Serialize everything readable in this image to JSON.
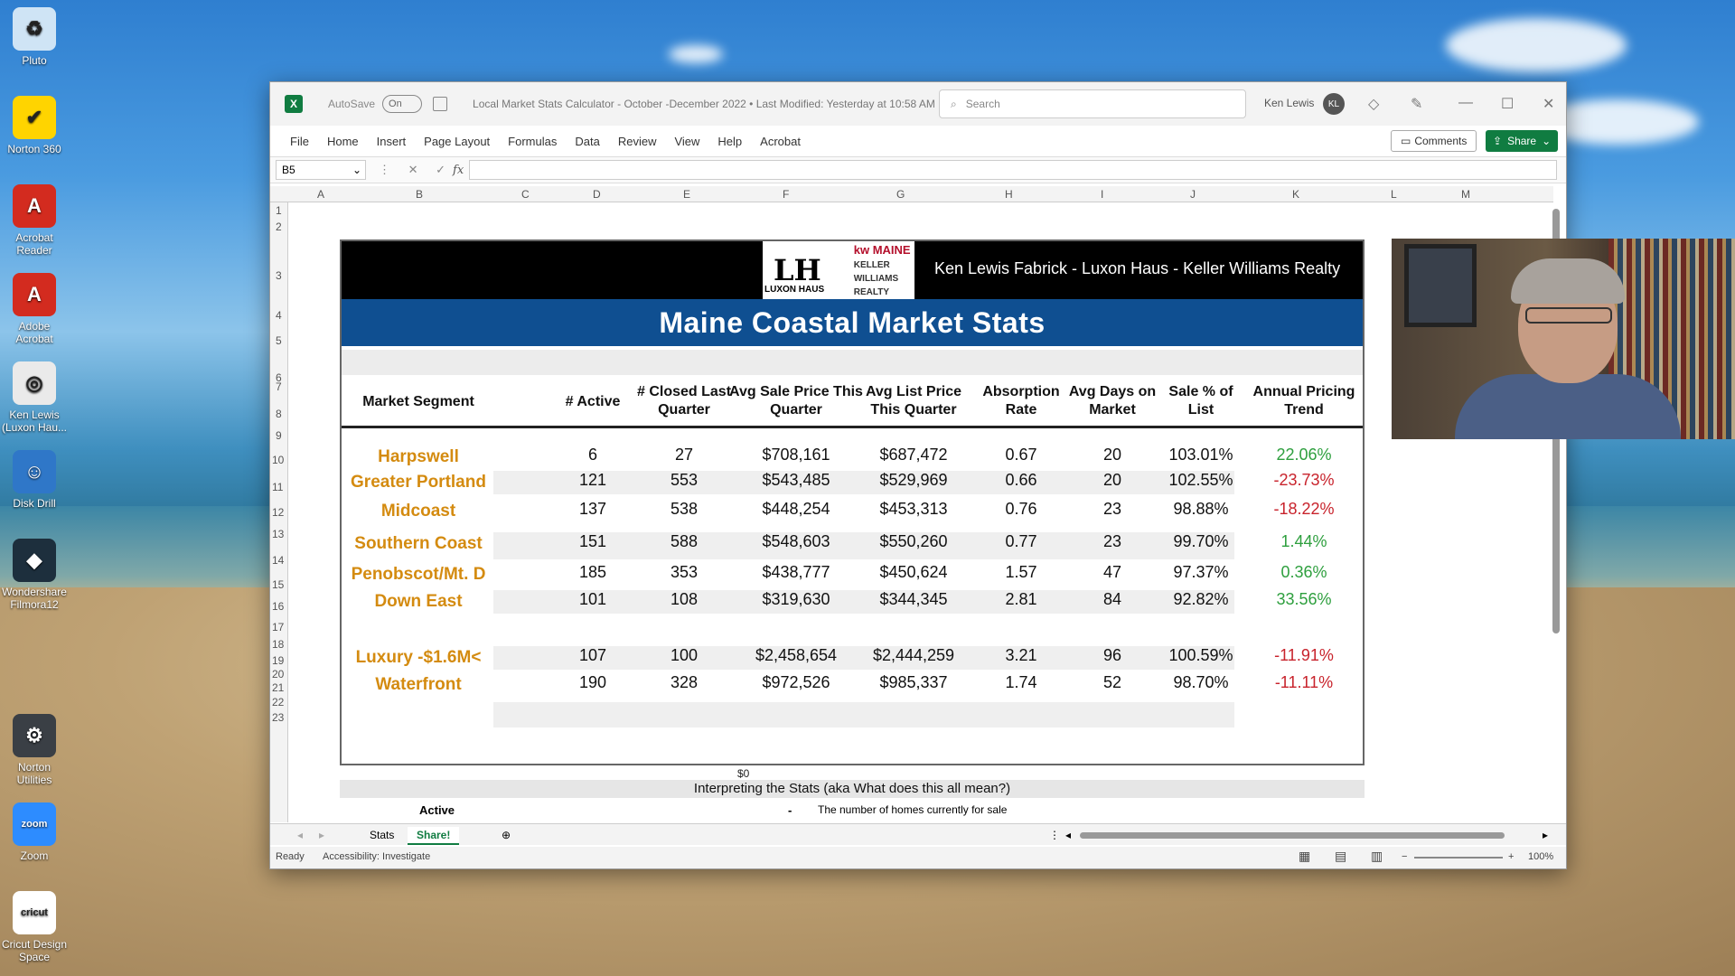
{
  "desktop": {
    "icons": [
      {
        "label": "Pluto",
        "color": "#cfe4f5",
        "glyph": "♻"
      },
      {
        "label": "Norton 360",
        "color": "#ffd400",
        "glyph": "✔"
      },
      {
        "label": "Acrobat Reader",
        "color": "#d32b1f",
        "glyph": "A"
      },
      {
        "label": "Adobe Acrobat",
        "color": "#d32b1f",
        "glyph": "A"
      },
      {
        "label": "Ken Lewis (Luxon Hau...",
        "color": "#eaeaea",
        "glyph": "◎"
      },
      {
        "label": "Disk Drill",
        "color": "#2f77c8",
        "glyph": "☺"
      },
      {
        "label": "Wondershare Filmora12",
        "color": "#1d2f3d",
        "glyph": "◆"
      },
      {
        "label": "Norton Utilities",
        "color": "#3a3f45",
        "glyph": "⚙"
      },
      {
        "label": "Zoom",
        "color": "#2d8cff",
        "glyph": "zoom"
      },
      {
        "label": "Cricut Design Space",
        "color": "#ffffff",
        "glyph": "cricut"
      }
    ]
  },
  "window": {
    "autosave_label": "AutoSave",
    "autosave_state": "On",
    "doc_title": "Local Market Stats Calculator - October -December  2022  •  Last Modified: Yesterday at 10:58 AM ⌄",
    "search_placeholder": "Search",
    "user_name": "Ken Lewis",
    "user_initials": "KL",
    "menu": [
      "File",
      "Home",
      "Insert",
      "Page Layout",
      "Formulas",
      "Data",
      "Review",
      "View",
      "Help",
      "Acrobat"
    ],
    "comments_label": "Comments",
    "share_label": "Share",
    "namebox": "B5",
    "fx": "fx"
  },
  "grid": {
    "columns": [
      "A",
      "B",
      "C",
      "D",
      "E",
      "F",
      "G",
      "H",
      "I",
      "J",
      "K",
      "L",
      "M"
    ],
    "rows": [
      "1",
      "2",
      "3",
      "4",
      "5",
      "6",
      "7",
      "8",
      "9",
      "10",
      "11",
      "12",
      "13",
      "14",
      "15",
      "16",
      "17",
      "18",
      "19",
      "20",
      "21",
      "22",
      "23"
    ]
  },
  "stats": {
    "logo_main": "LH",
    "logo_sub": "LUXON HAUS",
    "kw_main": "kw MAINE",
    "kw_sub": "KELLER WILLIAMS REALTY",
    "banner_text": "Ken Lewis Fabrick - Luxon Haus - Keller Williams Realty",
    "title": "Maine Coastal Market Stats",
    "headers": {
      "segment": "Market Segment",
      "active": "# Active",
      "closed": "# Closed Last Quarter",
      "avg_sale": "Avg Sale Price This Quarter",
      "avg_list": "Avg List Price This Quarter",
      "absorption": "Absorption Rate",
      "days": "Avg Days on Market",
      "sale_pct": "Sale % of List",
      "trend": "Annual Pricing Trend"
    },
    "rows": [
      {
        "segment": "Harpswell",
        "active": "6",
        "closed": "27",
        "avg_sale": "$708,161",
        "avg_list": "$687,472",
        "absorption": "0.67",
        "days": "20",
        "sale_pct": "103.01%",
        "trend": "22.06%",
        "trend_dir": "pos"
      },
      {
        "segment": "Greater Portland",
        "active": "121",
        "closed": "553",
        "avg_sale": "$543,485",
        "avg_list": "$529,969",
        "absorption": "0.66",
        "days": "20",
        "sale_pct": "102.55%",
        "trend": "-23.73%",
        "trend_dir": "neg"
      },
      {
        "segment": "Midcoast",
        "active": "137",
        "closed": "538",
        "avg_sale": "$448,254",
        "avg_list": "$453,313",
        "absorption": "0.76",
        "days": "23",
        "sale_pct": "98.88%",
        "trend": "-18.22%",
        "trend_dir": "neg"
      },
      {
        "segment": "Southern Coast",
        "active": "151",
        "closed": "588",
        "avg_sale": "$548,603",
        "avg_list": "$550,260",
        "absorption": "0.77",
        "days": "23",
        "sale_pct": "99.70%",
        "trend": "1.44%",
        "trend_dir": "pos"
      },
      {
        "segment": "Penobscot/Mt. D",
        "active": "185",
        "closed": "353",
        "avg_sale": "$438,777",
        "avg_list": "$450,624",
        "absorption": "1.57",
        "days": "47",
        "sale_pct": "97.37%",
        "trend": "0.36%",
        "trend_dir": "pos"
      },
      {
        "segment": "Down East",
        "active": "101",
        "closed": "108",
        "avg_sale": "$319,630",
        "avg_list": "$344,345",
        "absorption": "2.81",
        "days": "84",
        "sale_pct": "92.82%",
        "trend": "33.56%",
        "trend_dir": "pos"
      },
      {
        "segment": "Luxury -$1.6M<",
        "active": "107",
        "closed": "100",
        "avg_sale": "$2,458,654",
        "avg_list": "$2,444,259",
        "absorption": "3.21",
        "days": "96",
        "sale_pct": "100.59%",
        "trend": "-11.91%",
        "trend_dir": "neg"
      },
      {
        "segment": "Waterfront",
        "active": "190",
        "closed": "328",
        "avg_sale": "$972,526",
        "avg_list": "$985,337",
        "absorption": "1.74",
        "days": "52",
        "sale_pct": "98.70%",
        "trend": "-11.11%",
        "trend_dir": "neg"
      }
    ],
    "zero_value": "$0",
    "interpret_title": "Interpreting the Stats (aka What does this all mean?)",
    "interpret_term": "Active",
    "interpret_dash": "-",
    "interpret_desc": "The number of homes currently for sale"
  },
  "sheets": {
    "tabs": [
      "Stats",
      "Share!"
    ],
    "active": "Share!"
  },
  "status": {
    "ready": "Ready",
    "accessibility": "Accessibility: Investigate",
    "zoom": "100%"
  },
  "colors": {
    "excel_green": "#107c41",
    "banner_blue": "#0f4f91",
    "segment_orange": "#d48b10",
    "trend_up": "#2e9f3e",
    "trend_down": "#c8232c"
  }
}
